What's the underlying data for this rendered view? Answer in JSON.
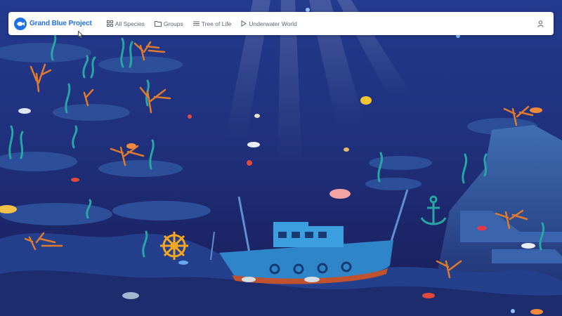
{
  "brand": {
    "name": "Grand Blue Project",
    "logo_icon": "fish-logo-icon",
    "color": "#1f6fe5"
  },
  "nav": {
    "items": [
      {
        "label": "All Species",
        "icon": "grid-icon"
      },
      {
        "label": "Groups",
        "icon": "folder-icon"
      },
      {
        "label": "Tree of Life",
        "icon": "list-icon"
      },
      {
        "label": "Underwater World",
        "icon": "play-icon"
      }
    ],
    "user_icon": "user-icon"
  },
  "scene": {
    "description_icons": [
      "shipwreck",
      "coral-reef",
      "anchor",
      "ship-wheel",
      "fish"
    ],
    "colors": {
      "deep": "#1a1f63",
      "mid": "#2c3f8f",
      "rock": "#3f6fb3",
      "coral": "#e07a2c",
      "seaweed": "#27a6a4"
    }
  }
}
